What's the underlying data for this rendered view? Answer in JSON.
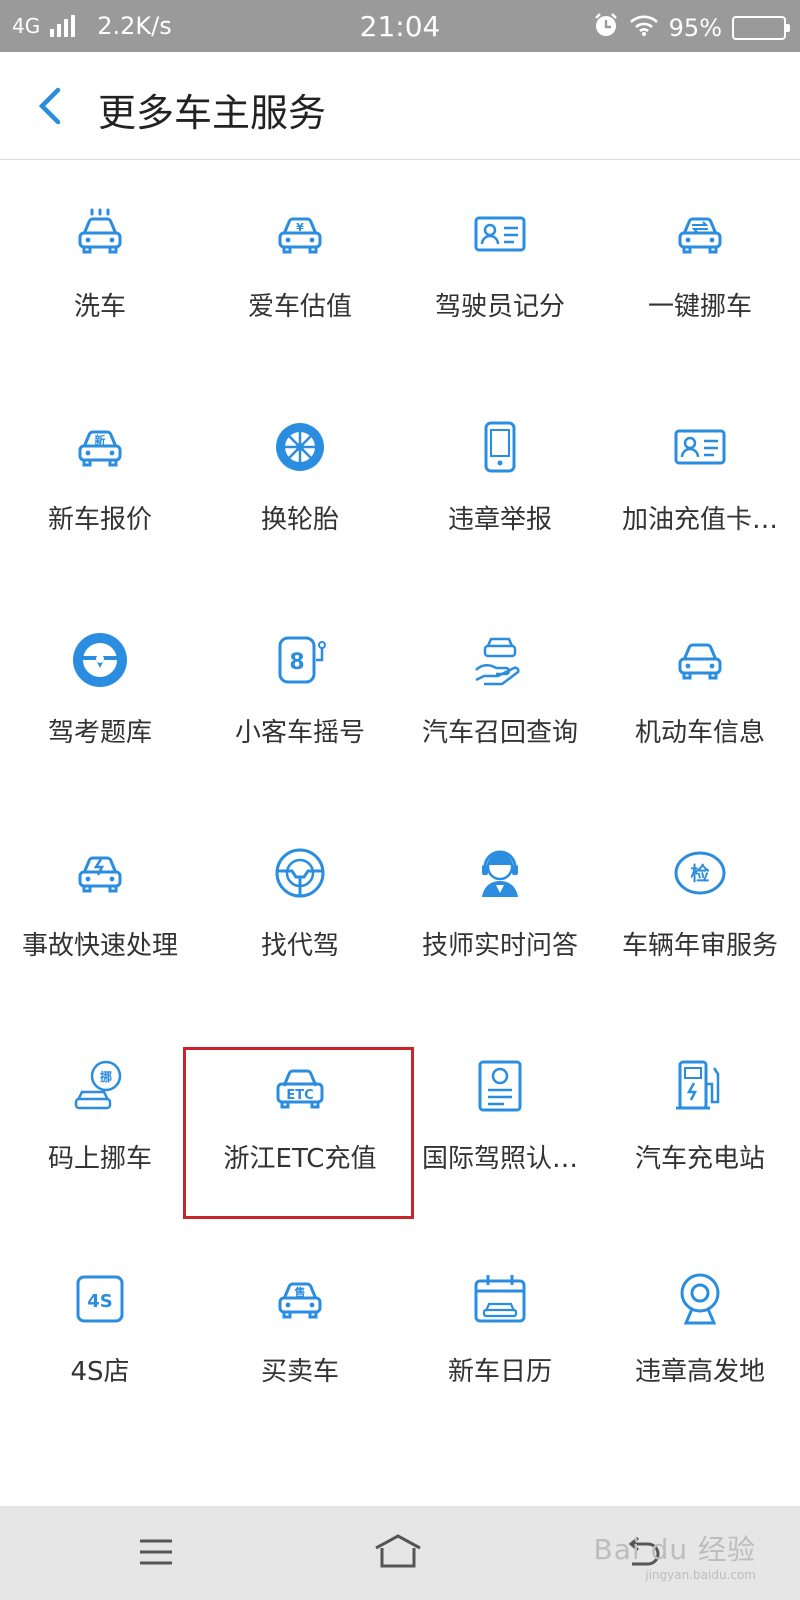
{
  "status_bar": {
    "network": "4G",
    "speed": "2.2K/s",
    "time": "21:04",
    "battery_pct": "95%",
    "battery_level": 0.95,
    "icons": [
      "signal-icon",
      "alarm-icon",
      "wifi-icon",
      "battery-icon"
    ]
  },
  "header": {
    "title": "更多车主服务",
    "back_icon": "chevron-left-icon"
  },
  "accent_color": "#2a8de0",
  "services": [
    {
      "label": "洗车",
      "icon": "car-wash-icon"
    },
    {
      "label": "爱车估值",
      "icon": "car-valuation-icon"
    },
    {
      "label": "驾驶员记分",
      "icon": "id-card-icon"
    },
    {
      "label": "一键挪车",
      "icon": "move-car-icon"
    },
    {
      "label": "新车报价",
      "icon": "new-car-icon"
    },
    {
      "label": "换轮胎",
      "icon": "tire-icon"
    },
    {
      "label": "违章举报",
      "icon": "phone-icon"
    },
    {
      "label": "加油充值卡…",
      "icon": "id-card-icon"
    },
    {
      "label": "驾考题库",
      "icon": "steering-wheel-filled-icon"
    },
    {
      "label": "小客车摇号",
      "icon": "lottery-number-icon"
    },
    {
      "label": "汽车召回查询",
      "icon": "hand-car-icon"
    },
    {
      "label": "机动车信息",
      "icon": "car-icon"
    },
    {
      "label": "事故快速处理",
      "icon": "accident-car-icon"
    },
    {
      "label": "找代驾",
      "icon": "steering-wheel-icon"
    },
    {
      "label": "技师实时问答",
      "icon": "technician-headset-icon"
    },
    {
      "label": "车辆年审服务",
      "icon": "inspection-icon"
    },
    {
      "label": "码上挪车",
      "icon": "scan-move-car-icon"
    },
    {
      "label": "浙江ETC充值",
      "icon": "etc-icon"
    },
    {
      "label": "国际驾照认…",
      "icon": "license-doc-icon"
    },
    {
      "label": "汽车充电站",
      "icon": "charging-station-icon"
    },
    {
      "label": "4S店",
      "icon": "4s-store-icon"
    },
    {
      "label": "买卖车",
      "icon": "sell-car-icon"
    },
    {
      "label": "新车日历",
      "icon": "calendar-icon"
    },
    {
      "label": "违章高发地",
      "icon": "camera-icon"
    }
  ],
  "icon_text": {
    "new": "新",
    "etc": "ETC",
    "sell": "售",
    "inspect": "检",
    "move": "挪",
    "four_s": "4S",
    "lottery": "8",
    "valuation": "¥"
  },
  "nav_bar": {
    "icons": [
      "menu-icon",
      "home-icon",
      "back-nav-icon"
    ],
    "watermark": "Bai du 经验",
    "watermark_url": "jingyan.baidu.com"
  }
}
